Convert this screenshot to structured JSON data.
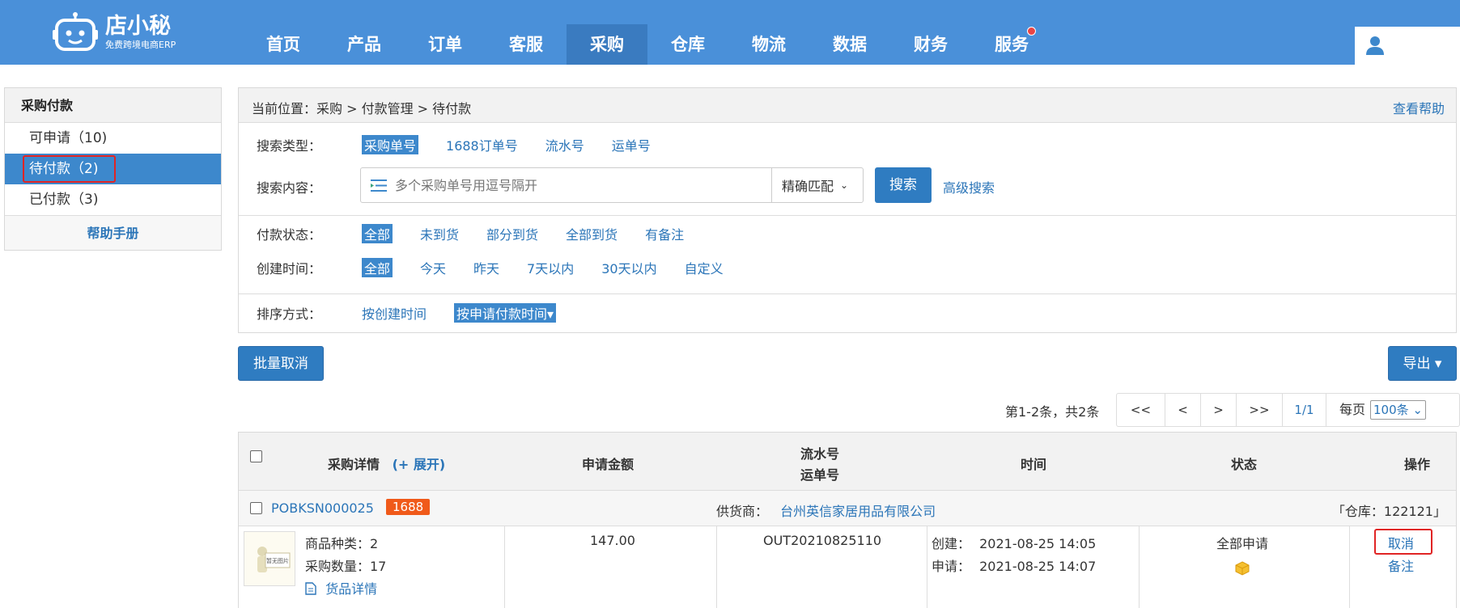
{
  "app": {
    "logo_title": "店小秘",
    "logo_sub": "免费跨境电商ERP"
  },
  "nav": [
    {
      "label": "首页"
    },
    {
      "label": "产品"
    },
    {
      "label": "订单"
    },
    {
      "label": "客服"
    },
    {
      "label": "采购"
    },
    {
      "label": "仓库"
    },
    {
      "label": "物流"
    },
    {
      "label": "数据"
    },
    {
      "label": "财务"
    },
    {
      "label": "服务"
    }
  ],
  "sidebar": {
    "title": "采购付款",
    "items": [
      {
        "label": "可申请（10)"
      },
      {
        "label": "待付款（2)"
      },
      {
        "label": "已付款（3)"
      }
    ],
    "help": "帮助手册"
  },
  "breadcrumb": "当前位置：采购 > 付款管理 > 待付款",
  "help_link": "查看帮助",
  "search": {
    "type_label": "搜索类型：",
    "types": [
      "采购单号",
      "1688订单号",
      "流水号",
      "运单号"
    ],
    "content_label": "搜索内容：",
    "placeholder": "多个采购单号用逗号隔开",
    "match": "精确匹配",
    "button": "搜索",
    "advanced": "高级搜索"
  },
  "filters": {
    "pay_status_label": "付款状态：",
    "pay_status": [
      "全部",
      "未到货",
      "部分到货",
      "全部到货",
      "有备注"
    ],
    "created_label": "创建时间：",
    "created": [
      "全部",
      "今天",
      "昨天",
      "7天以内",
      "30天以内",
      "自定义"
    ],
    "sort_label": "排序方式：",
    "sort": [
      "按创建时间",
      "按申请付款时间▾"
    ]
  },
  "toolbar": {
    "batch_cancel": "批量取消",
    "export": "导出 ▾"
  },
  "pager": {
    "info": "第1-2条，共2条",
    "first": "<<",
    "prev": "<",
    "next": ">",
    "last": ">>",
    "page": "1/1",
    "per_page_label": "每页",
    "per_page": "100条 ⌄"
  },
  "table": {
    "headers": {
      "detail": "采购详情",
      "expand": "(+ 展开)",
      "amount": "申请金额",
      "serial": "流水号",
      "waybill": "运单号",
      "time": "时间",
      "status": "状态",
      "action": "操作"
    },
    "order": {
      "po": "POBKSN000025",
      "tag": "1688",
      "supplier_label": "供货商：",
      "supplier": "台州英信家居用品有限公司",
      "warehouse": "「仓库：122121」",
      "thumb_text": "暂无图片",
      "kinds": "商品种类：2",
      "qty": "采购数量：17",
      "goods_detail": "货品详情",
      "amount": "147.00",
      "serial": "OUT20210825110",
      "created_label": "创建：",
      "created": "2021-08-25 14:05",
      "applied_label": "申请：",
      "applied": "2021-08-25 14:07",
      "status": "全部申请",
      "cancel": "取消",
      "remark": "备注"
    }
  }
}
